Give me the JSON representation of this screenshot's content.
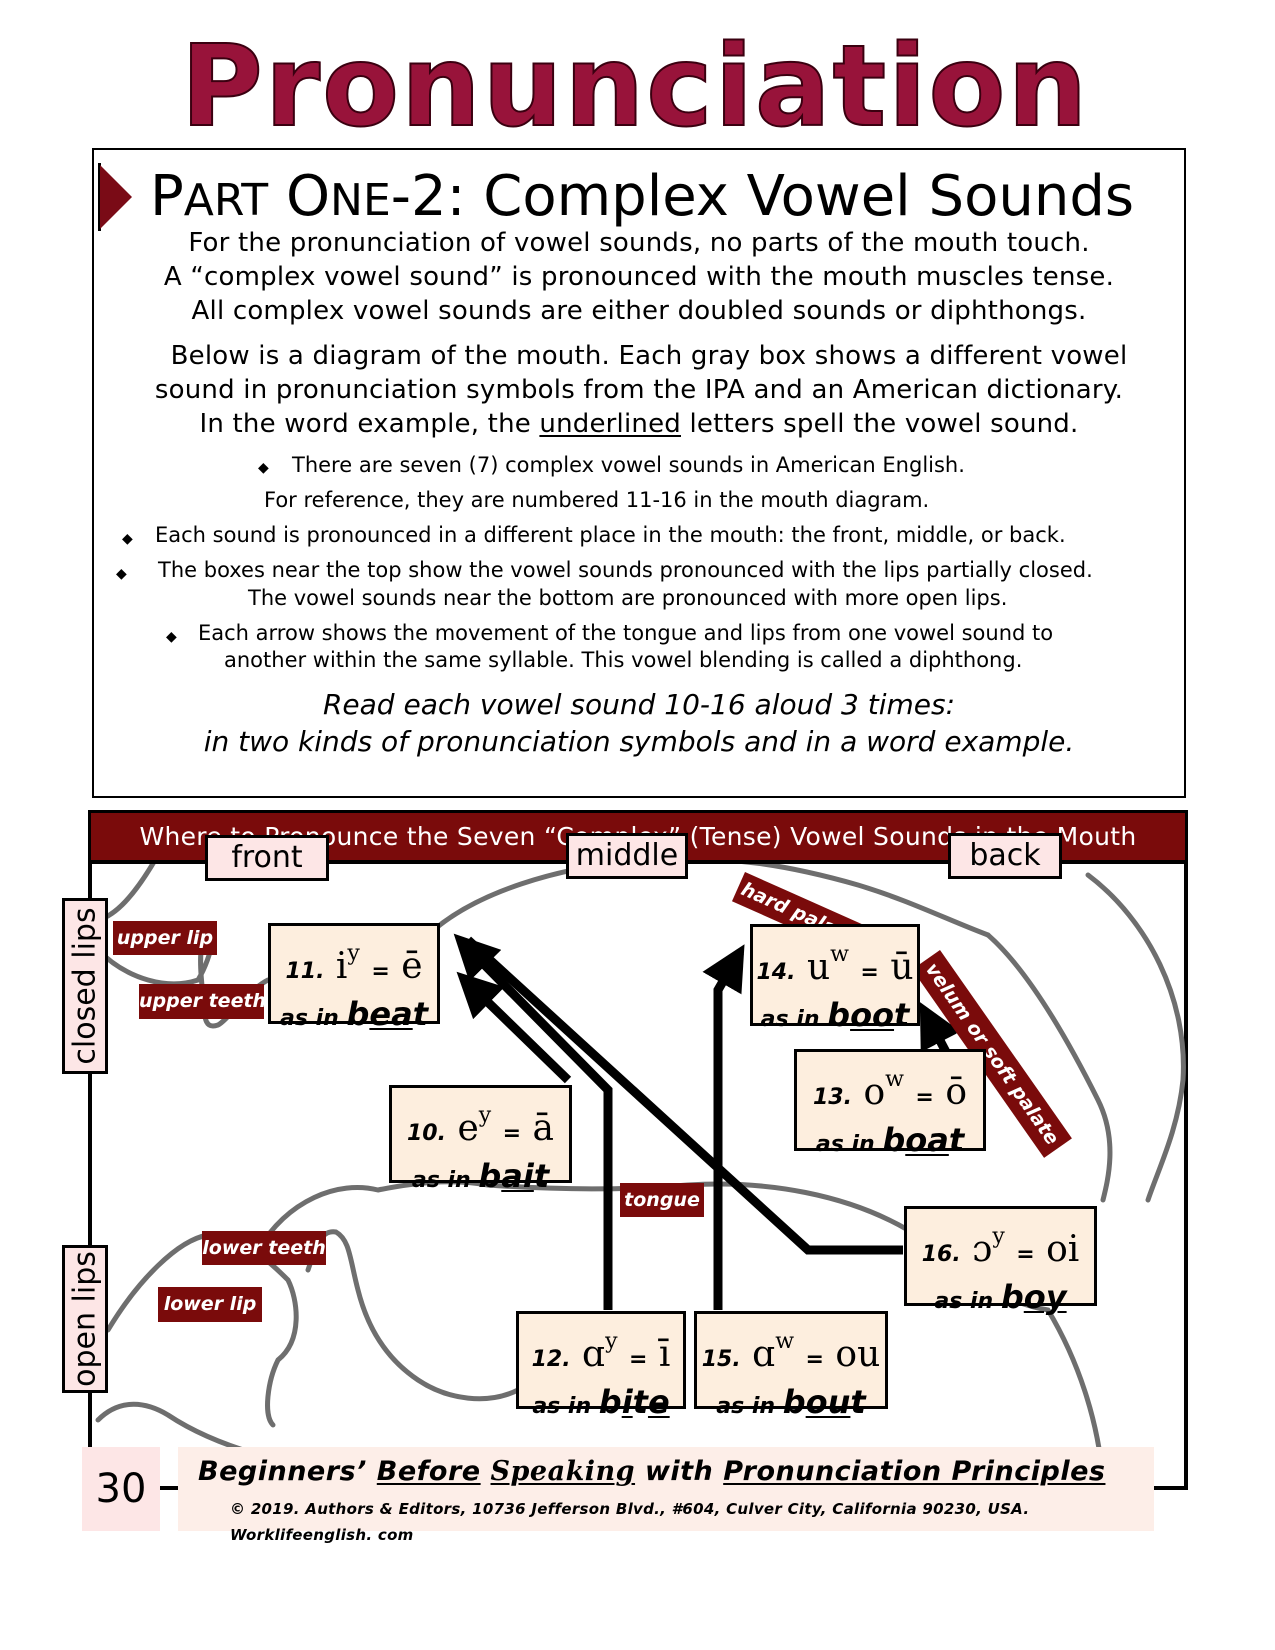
{
  "title": "Pronunciation",
  "part": {
    "prefix_cap_p": "P",
    "prefix_rest": "ART",
    "prefix_cap_o": " O",
    "prefix_rest2": "NE",
    "suffix": "-2: Complex Vowel Sounds"
  },
  "intro": {
    "line1": "For the pronunciation of vowel sounds, no parts of the mouth touch.",
    "line2": "A “complex vowel sound” is pronounced with the mouth muscles tense.",
    "line3": "All complex vowel sounds are either doubled sounds or diphthongs.",
    "line4": "Below is a diagram of the mouth. Each gray box shows a different vowel",
    "line5": "sound in pronunciation symbols from the IPA and an American dictionary.",
    "line6_a": "In the word example, the ",
    "line6_u": "underlined",
    "line6_b": " letters spell the vowel sound."
  },
  "bullets": {
    "b1": "There are seven (7) complex vowel sounds in American English.",
    "b1_cont": "For reference, they are numbered 11-16 in the mouth diagram.",
    "b2": "Each sound is pronounced in a different place in the mouth: the front, middle, or back.",
    "b3": "The boxes near the top show the vowel sounds pronounced with the lips partially closed.",
    "b3_cont": "The vowel sounds near the bottom are pronounced with more open lips.",
    "b4": "Each arrow shows the movement of the tongue and lips from one vowel sound to",
    "b4_cont": "another within the same syllable. This vowel blending is called a diphthong.",
    "glyph": "◆"
  },
  "instruction": {
    "line1": "Read each vowel sound 10-16 aloud 3 times:",
    "line2": "in two kinds of pronunciation symbols and in a word example."
  },
  "diagram": {
    "banner": "Where to Pronounce the Seven “Complex” (Tense) Vowel Sounds in the Mouth",
    "positions": {
      "front": "front",
      "middle": "middle",
      "back": "back"
    },
    "lips": {
      "closed": "closed lips",
      "open": "open lips"
    },
    "anatomy": {
      "upper_lip": "upper lip",
      "upper_teeth": "upper teeth",
      "lower_teeth": "lower teeth",
      "lower_lip": "lower lip",
      "tongue": "tongue",
      "hard_palate": "hard palate",
      "velum": "velum or soft palate"
    },
    "vowels": [
      {
        "num": "10.",
        "ipa": "e",
        "ipa_sup": "y",
        "eq": "=",
        "dict": "ā",
        "as_in": "as in",
        "w_pre": "b",
        "w_u": "ai",
        "w_post": "t"
      },
      {
        "num": "11.",
        "ipa": "i",
        "ipa_sup": "y",
        "eq": "=",
        "dict": "ē",
        "as_in": "as in",
        "w_pre": "b",
        "w_u": "ea",
        "w_post": "t"
      },
      {
        "num": "12.",
        "ipa": "ɑ",
        "ipa_sup": "y",
        "eq": "=",
        "dict": "ī",
        "as_in": "as in",
        "w_pre": "b",
        "w_u": "i",
        "w_mid": "t",
        "w_u2": "e",
        "w_post": ""
      },
      {
        "num": "13.",
        "ipa": "o",
        "ipa_sup": "w",
        "eq": "=",
        "dict": "ō",
        "as_in": "as in",
        "w_pre": "b",
        "w_u": "oa",
        "w_post": "t"
      },
      {
        "num": "14.",
        "ipa": "u",
        "ipa_sup": "w",
        "eq": "=",
        "dict": "ū",
        "as_in": "as in",
        "w_pre": "b",
        "w_u": "oo",
        "w_post": "t"
      },
      {
        "num": "15.",
        "ipa": "ɑ",
        "ipa_sup": "w",
        "eq": "=",
        "dict": "ou",
        "as_in": "as in",
        "w_pre": "b",
        "w_u": "ou",
        "w_post": "t"
      },
      {
        "num": "16.",
        "ipa": "ɔ",
        "ipa_sup": "y",
        "eq": "=",
        "dict": "oi",
        "as_in": "as in",
        "w_pre": "b",
        "w_u": "oy",
        "w_post": ""
      }
    ]
  },
  "footer": {
    "page_number": "30",
    "title_a": "Beginners’ ",
    "title_b": "Before",
    "title_c": " ",
    "title_script": "Speaking",
    "title_d": " with ",
    "title_e": "Pronunciation Principles",
    "copyright": "© 2019. Authors & Editors, 10736 Jefferson Blvd., #604, Culver City, California 90230, USA. Worklifeenglish. com"
  },
  "colors": {
    "title": "#98133a",
    "banner": "#7a0b0b",
    "label_bg": "#fde6e6",
    "vowel_bg": "#fdeede",
    "mouth_outline": "#6e6e6e"
  }
}
